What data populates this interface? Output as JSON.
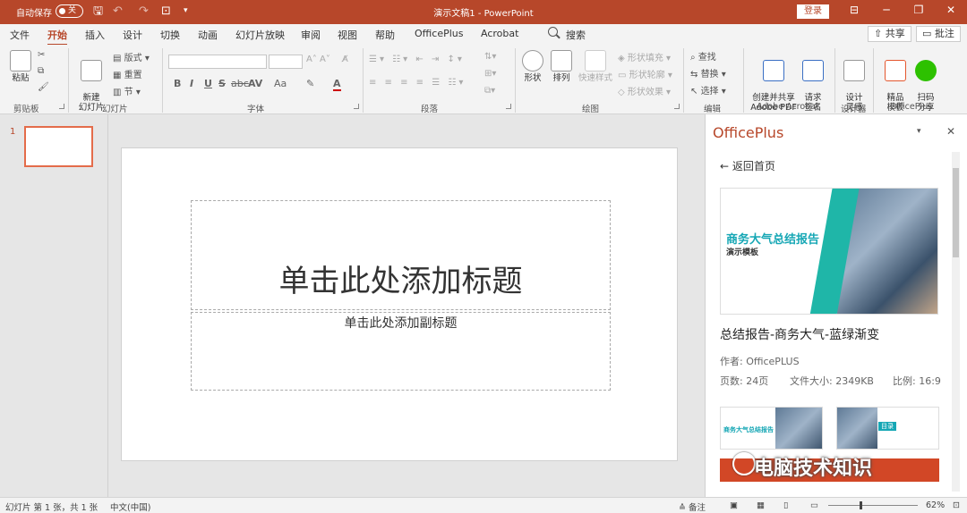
{
  "titlebar": {
    "autosave_label": "自动保存",
    "autosave_state": "关",
    "doc_title": "演示文稿1  -  PowerPoint",
    "login_label": "登录"
  },
  "tabs": [
    "文件",
    "开始",
    "插入",
    "设计",
    "切换",
    "动画",
    "幻灯片放映",
    "审阅",
    "视图",
    "帮助",
    "OfficePlus",
    "Acrobat"
  ],
  "active_tab": "开始",
  "search_label": "搜索",
  "share_label": "共享",
  "comment_label": "批注",
  "ribbon": {
    "clipboard": {
      "paste": "粘贴",
      "group": "剪贴板"
    },
    "slides": {
      "new_slide": "新建\n幻灯片",
      "layout": "版式",
      "reset": "重置",
      "section": "节",
      "group": "幻灯片"
    },
    "font": {
      "group": "字体",
      "buttons": [
        "B",
        "I",
        "U",
        "S",
        "abc",
        "AV",
        "Aa",
        "A"
      ]
    },
    "paragraph": {
      "group": "段落"
    },
    "drawing": {
      "shapes": "形状",
      "arrange": "排列",
      "quick_styles": "快速样式",
      "fill": "形状填充",
      "outline": "形状轮廓",
      "effects": "形状效果",
      "group": "绘图"
    },
    "editing": {
      "find": "查找",
      "replace": "替换",
      "select": "选择",
      "group": "编辑"
    },
    "acrobat": {
      "create_share": "创建并共享\nAdobe PDF",
      "request_sign": "请求\n签名",
      "group": "Adobe Acrobat"
    },
    "designer": {
      "design_ideas": "设计\n灵感",
      "group": "设计器"
    },
    "officeplus": {
      "templates": "精品\n模板",
      "scan_share": "扫码\n分享",
      "group": "OfficePlus"
    }
  },
  "thumbnails": {
    "slide_number": "1"
  },
  "slide": {
    "title_placeholder": "单击此处添加标题",
    "subtitle_placeholder": "单击此处添加副标题"
  },
  "panel": {
    "title": "OfficePlus",
    "back_label": "返回首页",
    "card_heading": "商务大气总结报告",
    "card_sub": "演示模板",
    "template_name": "总结报告-商务大气-蓝绿渐变",
    "author": "作者: OfficePLUS",
    "pages": "页数: 24页",
    "size": "文件大小: 2349KB",
    "ratio": "比例: 16:9",
    "mini_heading": "商务大气总结报告",
    "mini2_tag": "目录"
  },
  "watermark": "电脑技术知识",
  "statusbar": {
    "slide_info": "幻灯片 第 1 张，共 1 张",
    "language": "中文(中国)",
    "notes": "备注",
    "zoom": "62%"
  },
  "colors": {
    "accent": "#b7472a",
    "canvas": "#ffffff",
    "thumb_border": "#e46c4a"
  }
}
